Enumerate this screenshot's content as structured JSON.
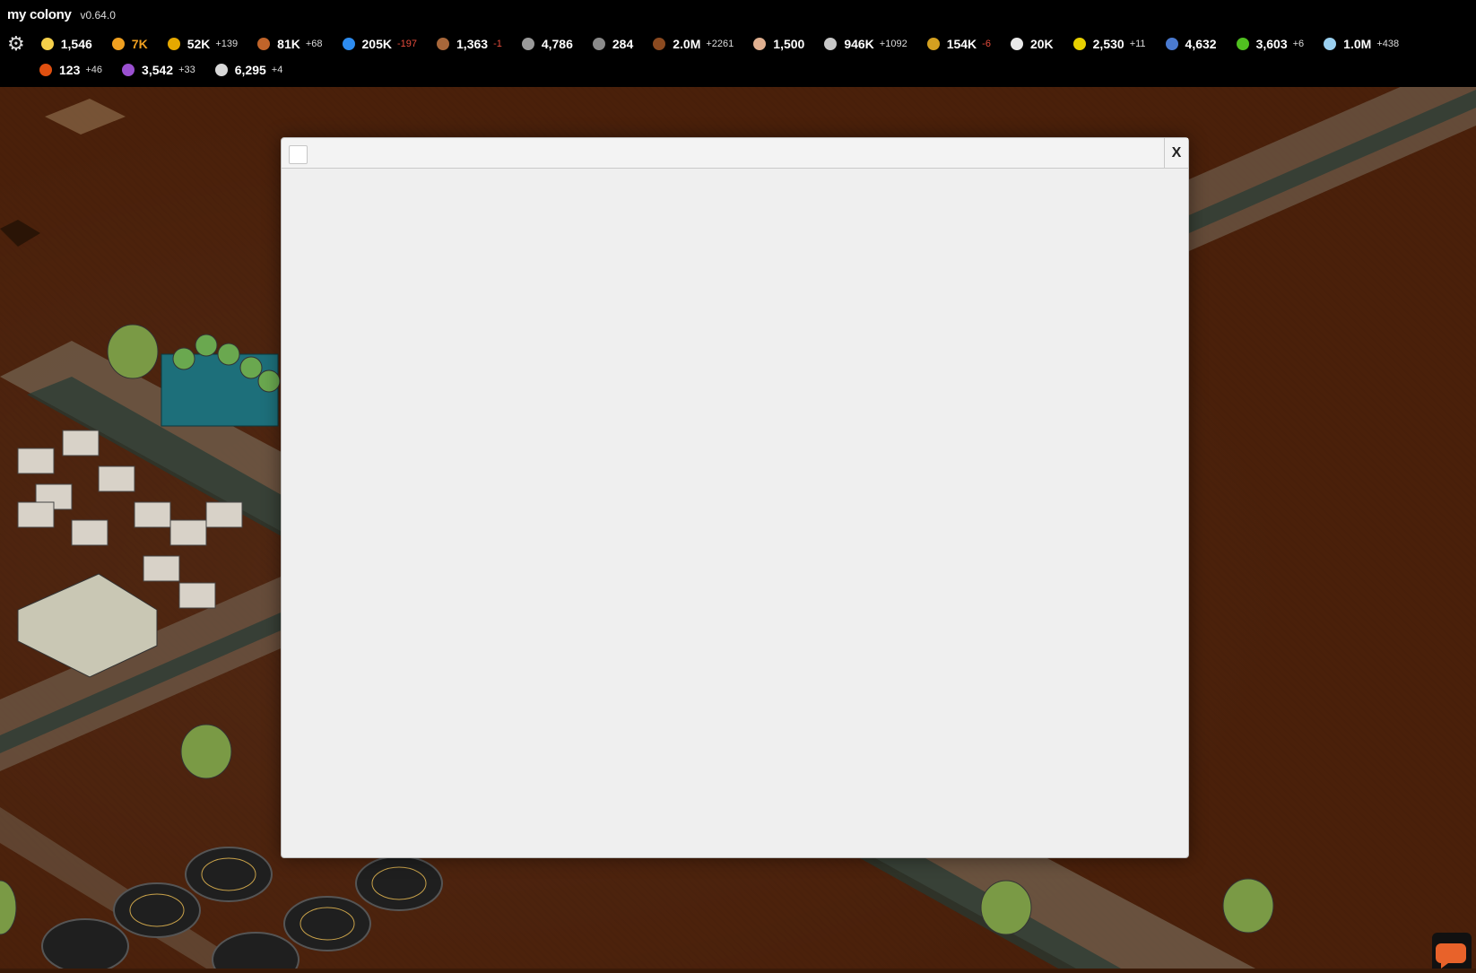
{
  "app": {
    "title": "my colony",
    "version": "v0.64.0"
  },
  "resources_row1": [
    {
      "icon": "colonist-icon",
      "value": "1,546",
      "delta": "",
      "neg": false,
      "color": "#f5d04a",
      "valueColor": "#ffffff"
    },
    {
      "icon": "energy-icon",
      "value": "7K",
      "delta": "",
      "neg": false,
      "color": "#f0a020",
      "valueColor": "#f0a020"
    },
    {
      "icon": "money-icon",
      "value": "52K",
      "delta": "+139",
      "neg": false,
      "color": "#e5a800",
      "valueColor": "#ffffff"
    },
    {
      "icon": "ore-icon",
      "value": "81K",
      "delta": "+68",
      "neg": false,
      "color": "#c0642a",
      "valueColor": "#ffffff"
    },
    {
      "icon": "water-icon",
      "value": "205K",
      "delta": "-197",
      "neg": true,
      "color": "#2d8cf0",
      "valueColor": "#ffffff"
    },
    {
      "icon": "bottle-icon",
      "value": "1,363",
      "delta": "-1",
      "neg": true,
      "color": "#a8673a",
      "valueColor": "#ffffff"
    },
    {
      "icon": "gear-resource-icon",
      "value": "4,786",
      "delta": "",
      "neg": false,
      "color": "#9a9a9a",
      "valueColor": "#ffffff"
    },
    {
      "icon": "brick-icon",
      "value": "284",
      "delta": "",
      "neg": false,
      "color": "#8a8a8a",
      "valueColor": "#ffffff"
    },
    {
      "icon": "regolith-icon",
      "value": "2.0M",
      "delta": "+2261",
      "neg": false,
      "color": "#8b4a20",
      "valueColor": "#ffffff"
    },
    {
      "icon": "food-icon",
      "value": "1,500",
      "delta": "",
      "neg": false,
      "color": "#e0b090",
      "valueColor": "#ffffff"
    },
    {
      "icon": "aluminum-icon",
      "value": "946K",
      "delta": "+1092",
      "neg": false,
      "color": "#c8c8c8",
      "valueColor": "#ffffff"
    },
    {
      "icon": "gold-icon",
      "value": "154K",
      "delta": "-6",
      "neg": true,
      "color": "#d4a020",
      "valueColor": "#ffffff"
    },
    {
      "icon": "microchip-icon",
      "value": "20K",
      "delta": "",
      "neg": false,
      "color": "#e8e8e8",
      "valueColor": "#ffffff"
    },
    {
      "icon": "uranium-icon",
      "value": "2,530",
      "delta": "+11",
      "neg": false,
      "color": "#e8d000",
      "valueColor": "#ffffff"
    },
    {
      "icon": "clothing-icon",
      "value": "4,632",
      "delta": "",
      "neg": false,
      "color": "#4a7ad0",
      "valueColor": "#ffffff"
    },
    {
      "icon": "algae-icon",
      "value": "3,603",
      "delta": "+6",
      "neg": false,
      "color": "#50c020",
      "valueColor": "#ffffff"
    },
    {
      "icon": "oxygen-icon",
      "value": "1.0M",
      "delta": "+438",
      "neg": false,
      "color": "#9ad0f0",
      "valueColor": "#ffffff"
    }
  ],
  "resources_row2": [
    {
      "icon": "fire-icon",
      "value": "123",
      "delta": "+46",
      "neg": false,
      "color": "#e05010",
      "valueColor": "#ffffff"
    },
    {
      "icon": "potion-icon",
      "value": "3,542",
      "delta": "+33",
      "neg": false,
      "color": "#9a50d0",
      "valueColor": "#ffffff"
    },
    {
      "icon": "civics-icon",
      "value": "6,295",
      "delta": "+4",
      "neg": false,
      "color": "#d8d8d8",
      "valueColor": "#ffffff"
    }
  ],
  "modal": {
    "close_label": "X"
  }
}
